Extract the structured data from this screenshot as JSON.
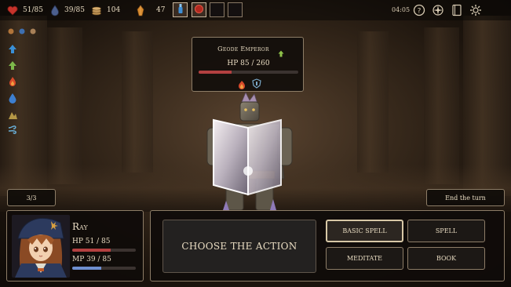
{
  "topbar": {
    "hp": "51/85",
    "mp": "39/85",
    "gold": "104",
    "crystals": "47",
    "slot_count_filled": 2,
    "time": "04:05",
    "icons": [
      "heart-icon",
      "water-drop-icon",
      "coin-stack-icon",
      "amber-crystal-icon",
      "blue-potion-icon",
      "red-orb-icon",
      "help-icon",
      "compass-icon",
      "book-icon",
      "settings-icon"
    ]
  },
  "left_status_icons": [
    "team-icon",
    "speed-up-icon",
    "attack-up-icon",
    "fire-icon",
    "water-icon",
    "earth-icon",
    "wind-icon"
  ],
  "enemy": {
    "name": "Geode Emperor",
    "hp_text": "HP 85 / 260",
    "hp_fraction": 0.33,
    "colors": {
      "hp": "#b34040"
    }
  },
  "turn_counter": "3/3",
  "end_turn": "End the turn",
  "hero": {
    "name": "Ray",
    "hp_text": "HP 51 / 85",
    "hp_fraction": 0.6,
    "mp_text": "MP 39 / 85",
    "mp_fraction": 0.46,
    "colors": {
      "hp": "#b34040",
      "mp": "#6f8fcf"
    }
  },
  "actions": {
    "prompt": "CHOOSE THE ACTION",
    "basic_spell": "BASIC SPELL",
    "spell": "SPELL",
    "meditate": "MEDITATE",
    "book": "BOOK"
  }
}
